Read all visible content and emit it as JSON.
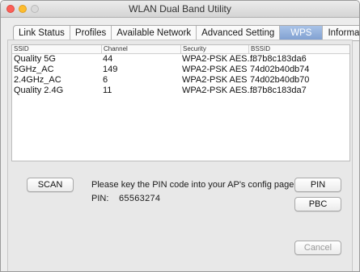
{
  "window": {
    "title": "WLAN Dual Band Utility"
  },
  "tabs": [
    {
      "label": "Link Status"
    },
    {
      "label": "Profiles"
    },
    {
      "label": "Available Network"
    },
    {
      "label": "Advanced Setting"
    },
    {
      "label": "WPS",
      "active": true
    },
    {
      "label": "Information"
    }
  ],
  "table": {
    "columns": [
      "SSID",
      "Channel",
      "Security",
      "BSSID"
    ],
    "rows": [
      [
        "Quality 5G",
        "44",
        "WPA2-PSK AES...",
        "f87b8c183da6"
      ],
      [
        "5GHz_AC",
        "149",
        "WPA2-PSK AES",
        "74d02b40db74"
      ],
      [
        "2.4GHz_AC",
        "6",
        "WPA2-PSK AES",
        "74d02b40db70"
      ],
      [
        "Quality 2.4G",
        "11",
        "WPA2-PSK AES...",
        "f87b8c183da7"
      ]
    ]
  },
  "wps": {
    "scan_label": "SCAN",
    "instruction": "Please key the PIN code into your AP's config page",
    "pin_label": "PIN:",
    "pin_value": "65563274",
    "pin_button": "PIN",
    "pbc_button": "PBC",
    "cancel_button": "Cancel"
  },
  "colors": {
    "active_tab": "#8fb0dc",
    "close_light": "#fc5f57",
    "minimize_light": "#fdbc2e"
  }
}
